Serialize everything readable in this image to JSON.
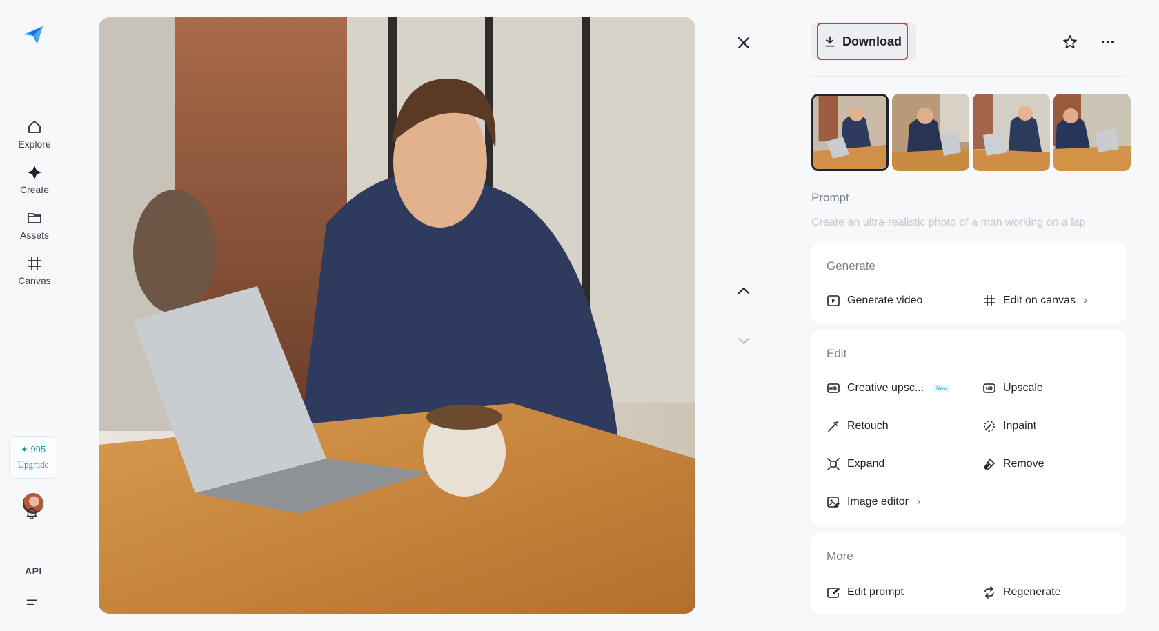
{
  "sidebar": {
    "logo_icon": "paper-plane-logo",
    "items": [
      {
        "label": "Explore",
        "icon": "home-icon"
      },
      {
        "label": "Create",
        "icon": "sparkle-icon"
      },
      {
        "label": "Assets",
        "icon": "folder-icon"
      },
      {
        "label": "Canvas",
        "icon": "canvas-icon"
      }
    ],
    "credits": {
      "amount": "✦ 995",
      "upgrade_label": "Upgrade"
    },
    "api_label": "API"
  },
  "viewer": {
    "icons": {
      "close": "close-icon",
      "prev": "chevron-up-icon",
      "next": "chevron-down-icon"
    }
  },
  "panel": {
    "download_label": "Download",
    "prompt_label": "Prompt",
    "prompt_text": "Create an ultra-realistic photo of a man working on a lap",
    "generate": {
      "title": "Generate",
      "actions": [
        {
          "label": "Generate video",
          "icon": "play-icon"
        },
        {
          "label": "Edit on canvas",
          "icon": "canvas-icon",
          "chevron": "›"
        }
      ]
    },
    "edit": {
      "title": "Edit",
      "actions": [
        {
          "label": "Creative upsc...",
          "icon": "hd-plus-icon",
          "badge": "New"
        },
        {
          "label": "Upscale",
          "icon": "hd-icon"
        },
        {
          "label": "Retouch",
          "icon": "magic-wand-icon"
        },
        {
          "label": "Inpaint",
          "icon": "inpaint-icon"
        },
        {
          "label": "Expand",
          "icon": "expand-icon"
        },
        {
          "label": "Remove",
          "icon": "eraser-icon"
        },
        {
          "label": "Image editor",
          "icon": "image-edit-icon",
          "chevron": "›"
        }
      ]
    },
    "more": {
      "title": "More",
      "actions": [
        {
          "label": "Edit prompt",
          "icon": "edit-prompt-icon"
        },
        {
          "label": "Regenerate",
          "icon": "regenerate-icon"
        }
      ]
    }
  },
  "colors": {
    "accent": "#1a9aa8",
    "highlight_border": "#e5342f",
    "text": "#1f2329",
    "muted": "#7a8089"
  }
}
